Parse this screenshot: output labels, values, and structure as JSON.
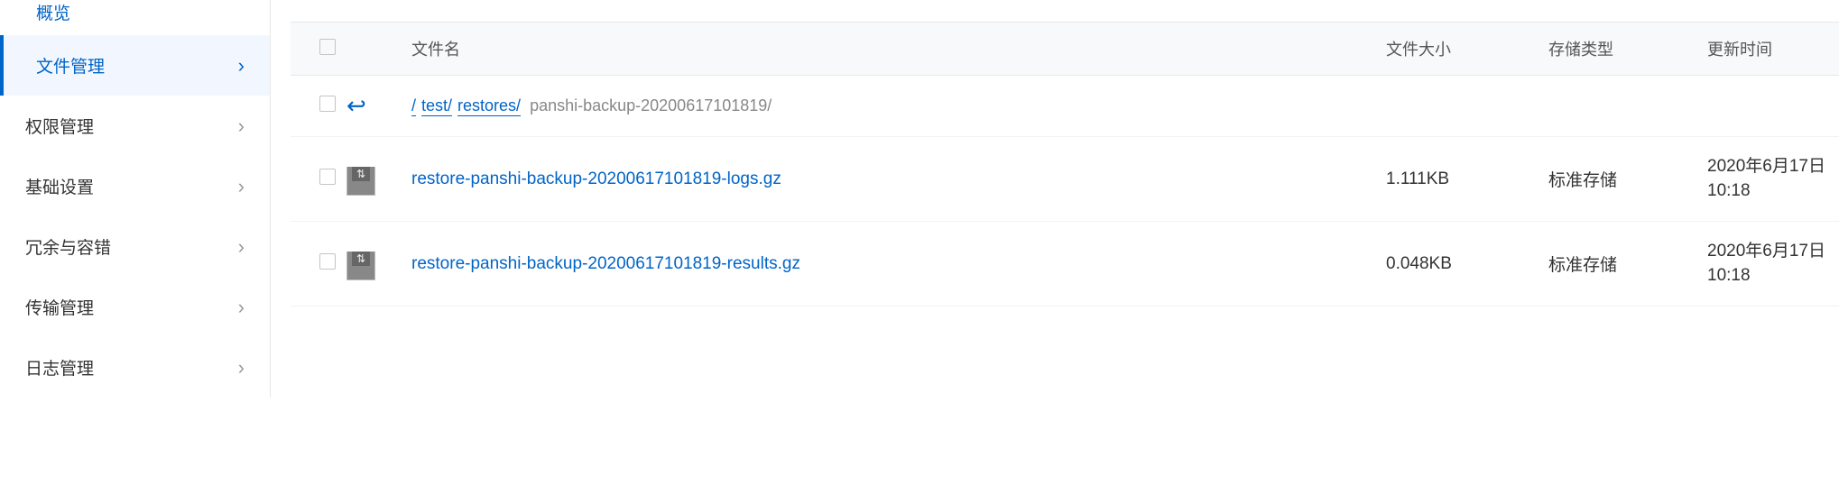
{
  "sidebar": {
    "items": [
      {
        "label": "概览"
      },
      {
        "label": "文件管理"
      },
      {
        "label": "权限管理"
      },
      {
        "label": "基础设置"
      },
      {
        "label": "冗余与容错"
      },
      {
        "label": "传输管理"
      },
      {
        "label": "日志管理"
      }
    ]
  },
  "table": {
    "headers": {
      "name": "文件名",
      "size": "文件大小",
      "storage": "存储类型",
      "updated": "更新时间"
    },
    "breadcrumb": {
      "root": "/",
      "parts": [
        "test/",
        "restores/"
      ],
      "current": "panshi-backup-20200617101819/"
    },
    "rows": [
      {
        "name": "restore-panshi-backup-20200617101819-logs.gz",
        "size": "1.111KB",
        "storage": "标准存储",
        "updated": "2020年6月17日 10:18"
      },
      {
        "name": "restore-panshi-backup-20200617101819-results.gz",
        "size": "0.048KB",
        "storage": "标准存储",
        "updated": "2020年6月17日 10:18"
      }
    ]
  }
}
